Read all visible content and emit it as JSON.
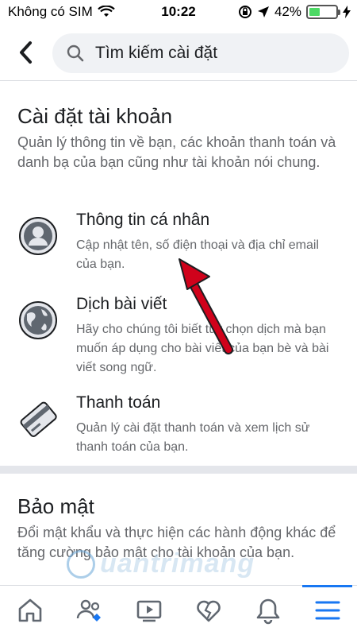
{
  "status_bar": {
    "carrier": "Không có SIM",
    "time": "10:22",
    "battery": "42%",
    "battery_level": 0.42
  },
  "header": {
    "search_placeholder": "Tìm kiếm cài đặt"
  },
  "account_section": {
    "title": "Cài đặt tài khoản",
    "description": "Quản lý thông tin về bạn, các khoản thanh toán và danh bạ của bạn cũng như tài khoản nói chung.",
    "items": [
      {
        "title": "Thông tin cá nhân",
        "description": "Cập nhật tên, số điện thoại và địa chỉ email của bạn.",
        "icon": "profile-icon"
      },
      {
        "title": "Dịch bài viết",
        "description": "Hãy cho chúng tôi biết tùy chọn dịch mà bạn muốn áp dụng cho bài viết của bạn bè và bài viết song ngữ.",
        "icon": "globe-icon"
      },
      {
        "title": "Thanh toán",
        "description": "Quản lý cài đặt thanh toán và xem lịch sử thanh toán của bạn.",
        "icon": "credit-card-icon"
      }
    ]
  },
  "security_section": {
    "title": "Bảo mật",
    "description": "Đổi mật khẩu và thực hiện các hành động khác để tăng cường bảo mật cho tài khoản của bạn."
  },
  "tab_bar": {
    "tabs": [
      {
        "icon": "home-icon",
        "active": false
      },
      {
        "icon": "friends-icon",
        "active": false
      },
      {
        "icon": "watch-icon",
        "active": false
      },
      {
        "icon": "dating-icon",
        "active": false
      },
      {
        "icon": "bell-icon",
        "active": false
      },
      {
        "icon": "menu-icon",
        "active": true
      }
    ]
  },
  "watermark": {
    "text": "uantrimang"
  },
  "colors": {
    "accent": "#1877f2",
    "arrow": "#d0021b",
    "secondary_text": "#65676b"
  }
}
